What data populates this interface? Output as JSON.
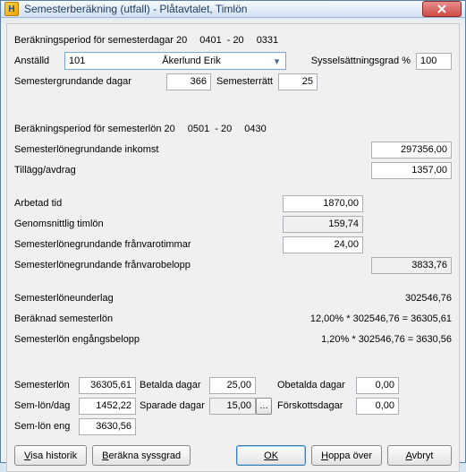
{
  "window": {
    "title": "Semesterberäkning (utfall) - Plåtavtalet, Timlön",
    "icon_letter": "H"
  },
  "period_days": {
    "label": "Beräkningsperiod för semesterdagar 20",
    "from": "0401",
    "sep": "- 20",
    "to": "0331"
  },
  "employee": {
    "label": "Anställd",
    "id": "101",
    "name": "Åkerlund Erik"
  },
  "syssel": {
    "label": "Sysselsättningsgrad %",
    "value": "100"
  },
  "sem_dagar": {
    "label": "Semestergrundande dagar",
    "value": "366"
  },
  "sem_ratt": {
    "label": "Semesterrätt",
    "value": "25"
  },
  "period_lon": {
    "label": "Beräkningsperiod för semesterlön 20",
    "from": "0501",
    "sep": "- 20",
    "to": "0430"
  },
  "inkomst": {
    "label": "Semesterlönegrundande inkomst",
    "value": "297356,00"
  },
  "tillagg": {
    "label": "Tillägg/avdrag",
    "value": "1357,00"
  },
  "arbetad": {
    "label": "Arbetad tid",
    "value": "1870,00"
  },
  "timlon": {
    "label": "Genomsnittlig timlön",
    "value": "159,74"
  },
  "franvarotimmar": {
    "label": "Semesterlönegrundande frånvarotimmar",
    "value": "24,00"
  },
  "franvarobelopp": {
    "label": "Semesterlönegrundande frånvarobelopp",
    "value": "3833,76"
  },
  "underlag": {
    "label": "Semesterlöneunderlag",
    "value": "302546,76"
  },
  "beraknad": {
    "label": "Beräknad semesterlön",
    "value": "12,00% * 302546,76 = 36305,61"
  },
  "engang": {
    "label": "Semesterlön engångsbelopp",
    "value": "1,20% * 302546,76 = 3630,56"
  },
  "footer": {
    "semesterlon": {
      "label": "Semesterlön",
      "value": "36305,61"
    },
    "betalda": {
      "label": "Betalda dagar",
      "value": "25,00"
    },
    "obetalda": {
      "label": "Obetalda dagar",
      "value": "0,00"
    },
    "sem_lon_dag": {
      "label": "Sem-lön/dag",
      "value": "1452,22"
    },
    "sparade": {
      "label": "Sparade dagar",
      "value": "15,00"
    },
    "forskott": {
      "label": "Förskottsdagar",
      "value": "0,00"
    },
    "sem_lon_eng": {
      "label": "Sem-lön eng",
      "value": "3630,56"
    }
  },
  "buttons": {
    "historik": "Visa historik",
    "syssgrad": "Beräkna syssgrad",
    "ok": "OK",
    "hoppa": "Hoppa över",
    "avbryt": "Avbryt"
  }
}
